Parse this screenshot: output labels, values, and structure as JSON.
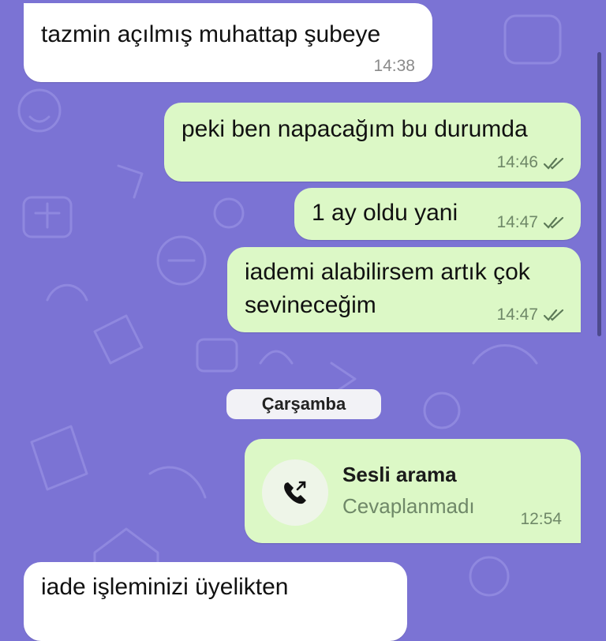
{
  "messages": [
    {
      "direction": "incoming",
      "text": "tazmin açılmış muhattap şubeye",
      "time": "14:38"
    },
    {
      "direction": "outgoing",
      "text": "peki ben napacağım bu durumda",
      "time": "14:46",
      "status": "read"
    },
    {
      "direction": "outgoing",
      "text": "1 ay oldu yani",
      "time": "14:47",
      "status": "read"
    },
    {
      "direction": "outgoing",
      "text_lines": [
        "iademi alabilirsem artık çok",
        "sevineceğim"
      ],
      "time": "14:47",
      "status": "read"
    }
  ],
  "date_separator": "Çarşamba",
  "call": {
    "title": "Sesli arama",
    "status": "Cevaplanmadı",
    "time": "12:54",
    "icon": "outgoing-call-icon"
  },
  "partial_message": {
    "direction": "incoming",
    "text": "iade işleminizi üyelikten"
  },
  "colors": {
    "wallpaper": "#7b73d4",
    "incoming": "#ffffff",
    "outgoing": "#dcf8c6",
    "ticks": "#5d7a58"
  }
}
